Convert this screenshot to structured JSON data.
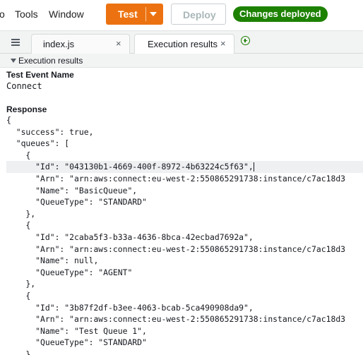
{
  "menu": {
    "item_partial": "o",
    "tools": "Tools",
    "window": "Window"
  },
  "toolbar": {
    "test_label": "Test",
    "deploy_label": "Deploy",
    "status_badge": "Changes deployed",
    "colors": {
      "test": "#ec7211",
      "badge": "#1d8102"
    }
  },
  "tabs": [
    {
      "label": "index.js",
      "close": "×"
    },
    {
      "label": "Execution results",
      "close": "×",
      "active": true
    }
  ],
  "section": {
    "title": "Execution results"
  },
  "result": {
    "event_name_label": "Test Event Name",
    "event_name_value": "Connect",
    "response_label": "Response",
    "code_lines": [
      "{",
      "  \"success\": true,",
      "  \"queues\": [",
      "    {",
      "      \"Id\": \"043130b1-4669-400f-8972-4b63224c5f63\",",
      "      \"Arn\": \"arn:aws:connect:eu-west-2:550865291738:instance/c7ac18d3",
      "      \"Name\": \"BasicQueue\",",
      "      \"QueueType\": \"STANDARD\"",
      "    },",
      "    {",
      "      \"Id\": \"2caba5f3-b33a-4636-8bca-42ecbad7692a\",",
      "      \"Arn\": \"arn:aws:connect:eu-west-2:550865291738:instance/c7ac18d3",
      "      \"Name\": null,",
      "      \"QueueType\": \"AGENT\"",
      "    },",
      "    {",
      "      \"Id\": \"3b87f2df-b3ee-4063-bcab-5ca490908da9\",",
      "      \"Arn\": \"arn:aws:connect:eu-west-2:550865291738:instance/c7ac18d3",
      "      \"Name\": \"Test Queue 1\",",
      "      \"QueueType\": \"STANDARD\"",
      "    },",
      "    {"
    ],
    "highlighted_line": 4
  }
}
